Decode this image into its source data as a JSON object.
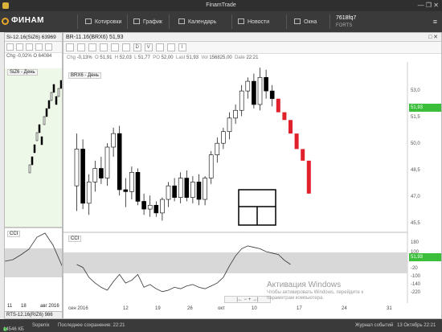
{
  "window": {
    "title": "FinamTrade",
    "controls": "—  ❐  ✕"
  },
  "toolbar": {
    "logo": "ФИНАМ",
    "items": [
      "Котировки",
      "График",
      "Календарь",
      "Новости",
      "Окна"
    ],
    "account": {
      "id": "7618fq7",
      "market": "FORTS"
    },
    "menu_icon": "≡"
  },
  "left_panel": {
    "title": "Si-12.16(SiZ6) 63969",
    "info": "Chg -0,02%  O 64084",
    "legend": "SiZ6 - День",
    "indicator": "CCI",
    "xlabels": [
      "11",
      "18",
      "авг 2016"
    ],
    "bottom_title": "RTS-12.16(RIZ6) 986"
  },
  "main_panel": {
    "title": "BR-11.16(BRX6) 51,93",
    "header_controls": "□ ✕",
    "tool_buttons": [
      "",
      "",
      "",
      "",
      "",
      "",
      "D",
      "V",
      "",
      "",
      "I"
    ],
    "info": [
      {
        "k": "Chg",
        "v": "-0,13%"
      },
      {
        "k": "O",
        "v": "51,91"
      },
      {
        "k": "H",
        "v": "52,03"
      },
      {
        "k": "L",
        "v": "51,77"
      },
      {
        "k": "PO",
        "v": "52,00"
      },
      {
        "k": "Last",
        "v": "51,93"
      },
      {
        "k": "Vol",
        "v": "156825,00"
      },
      {
        "k": "Date",
        "v": "22:21"
      }
    ],
    "legend": "BRX6 - День",
    "indicator": "CCI",
    "yticks": [
      "53,0",
      "51,5",
      "50,0",
      "48,5",
      "47,0",
      "45,5"
    ],
    "last_price": "51,93",
    "cci_yticks": [
      "180",
      "100",
      "-20",
      "-100",
      "-140",
      "-220"
    ],
    "cci_last": "51,93",
    "xlabels": [
      "сен 2016",
      "12",
      "19",
      "26",
      "окт",
      "10",
      "17",
      "24",
      "31"
    ],
    "pager": "|←  −  +  →|"
  },
  "watermark": {
    "title": "Активация Windows",
    "text": "Чтобы активировать Windows, перейдите к параметрам компьютера."
  },
  "statusbar": {
    "connection": "14546 КБ",
    "user": "Sopenix",
    "save": "Последнее сохранение: 22:21",
    "journal": "Журнал событий",
    "date": "13 Октябрь 22:21"
  },
  "colors": {
    "up": "#ffffff",
    "down": "#000000",
    "forecast": "#e0202a",
    "accent": "#3bbf3b"
  },
  "chart_data": {
    "type": "candlestick",
    "title": "BR-11.16(BRX6) 51,93",
    "ylim": [
      45.0,
      53.8
    ],
    "series": [
      {
        "o": 47.4,
        "h": 50.1,
        "l": 46.1,
        "c": 49.3
      },
      {
        "o": 49.3,
        "h": 49.8,
        "l": 46.2,
        "c": 46.5
      },
      {
        "o": 46.5,
        "h": 48.0,
        "l": 45.9,
        "c": 47.6
      },
      {
        "o": 47.6,
        "h": 48.7,
        "l": 47.1,
        "c": 48.3
      },
      {
        "o": 48.3,
        "h": 48.9,
        "l": 47.5,
        "c": 47.8
      },
      {
        "o": 47.8,
        "h": 49.6,
        "l": 47.4,
        "c": 49.4
      },
      {
        "o": 49.4,
        "h": 50.4,
        "l": 48.9,
        "c": 50.1
      },
      {
        "o": 50.1,
        "h": 50.5,
        "l": 46.9,
        "c": 47.2
      },
      {
        "o": 47.2,
        "h": 47.8,
        "l": 46.3,
        "c": 47.1
      },
      {
        "o": 47.1,
        "h": 48.4,
        "l": 46.7,
        "c": 48.1
      },
      {
        "o": 48.1,
        "h": 48.3,
        "l": 46.4,
        "c": 46.6
      },
      {
        "o": 46.6,
        "h": 47.0,
        "l": 45.9,
        "c": 46.2
      },
      {
        "o": 46.2,
        "h": 46.9,
        "l": 45.8,
        "c": 46.4
      },
      {
        "o": 46.4,
        "h": 46.6,
        "l": 45.8,
        "c": 46.0
      },
      {
        "o": 46.0,
        "h": 46.8,
        "l": 45.6,
        "c": 46.7
      },
      {
        "o": 46.7,
        "h": 47.6,
        "l": 46.3,
        "c": 47.4
      },
      {
        "o": 47.4,
        "h": 47.8,
        "l": 46.6,
        "c": 46.8
      },
      {
        "o": 46.8,
        "h": 48.1,
        "l": 46.5,
        "c": 47.8
      },
      {
        "o": 47.8,
        "h": 48.2,
        "l": 46.6,
        "c": 46.8
      },
      {
        "o": 46.8,
        "h": 47.9,
        "l": 46.5,
        "c": 47.6
      },
      {
        "o": 47.6,
        "h": 48.0,
        "l": 46.4,
        "c": 46.7
      },
      {
        "o": 46.7,
        "h": 47.9,
        "l": 46.4,
        "c": 47.8
      },
      {
        "o": 47.8,
        "h": 49.2,
        "l": 47.5,
        "c": 49.0
      },
      {
        "o": 49.0,
        "h": 49.9,
        "l": 48.6,
        "c": 49.6
      },
      {
        "o": 49.6,
        "h": 50.4,
        "l": 49.3,
        "c": 50.2
      },
      {
        "o": 50.2,
        "h": 51.2,
        "l": 49.8,
        "c": 50.9
      },
      {
        "o": 50.9,
        "h": 51.6,
        "l": 50.6,
        "c": 51.3
      },
      {
        "o": 51.3,
        "h": 52.6,
        "l": 51.0,
        "c": 52.3
      },
      {
        "o": 52.3,
        "h": 53.0,
        "l": 51.9,
        "c": 52.8
      },
      {
        "o": 52.8,
        "h": 53.2,
        "l": 51.4,
        "c": 51.6
      },
      {
        "o": 51.6,
        "h": 53.5,
        "l": 51.3,
        "c": 53.0
      },
      {
        "o": 53.0,
        "h": 53.4,
        "l": 51.9,
        "c": 52.3
      },
      {
        "o": 52.3,
        "h": 52.6,
        "l": 51.5,
        "c": 51.9
      }
    ],
    "forecast": [
      51.9,
      51.2,
      50.8,
      50.1,
      49.3,
      48.7,
      47.0
    ],
    "cci": [
      30,
      10,
      -60,
      -100,
      -130,
      -150,
      -90,
      -40,
      -100,
      -80,
      -40,
      -130,
      -110,
      -140,
      -160,
      -150,
      -130,
      -140,
      -120,
      -110,
      -130,
      -140,
      -120,
      -100,
      -60,
      20,
      90,
      140,
      160,
      150,
      140,
      120,
      110,
      100,
      60,
      30
    ],
    "cci_ylim": [
      -240,
      210
    ]
  }
}
